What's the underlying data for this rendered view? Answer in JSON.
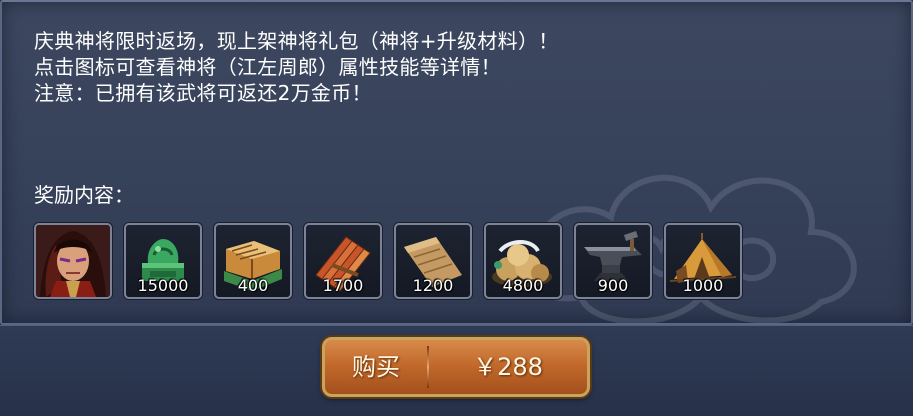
{
  "description": {
    "lines": [
      "庆典神将限时返场，现上架神将礼包（神将+升级材料）！",
      "点击图标可查看神将（江左周郎）属性技能等详情！",
      "注意：已拥有该武将可返还2万金币！"
    ]
  },
  "rewards": {
    "title": "奖励内容：",
    "items": [
      {
        "icon": "general-portrait-icon",
        "count": ""
      },
      {
        "icon": "jade-seal-icon",
        "count": "15000"
      },
      {
        "icon": "book-scroll-icon",
        "count": "400"
      },
      {
        "icon": "bamboo-scroll-icon",
        "count": "1700"
      },
      {
        "icon": "parchment-icon",
        "count": "1200"
      },
      {
        "icon": "ore-pile-icon",
        "count": "4800"
      },
      {
        "icon": "anvil-icon",
        "count": "900"
      },
      {
        "icon": "tent-icon",
        "count": "1000"
      }
    ]
  },
  "purchase": {
    "label": "购买",
    "price": "￥288"
  }
}
